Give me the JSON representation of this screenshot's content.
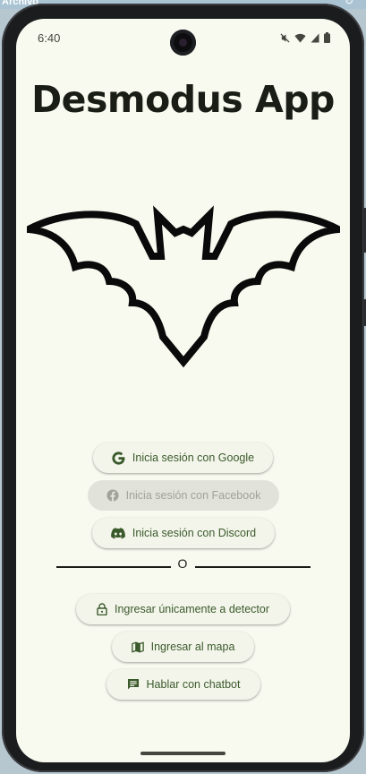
{
  "host": {
    "title": "Archivo"
  },
  "status_bar": {
    "time": "6:40",
    "icons": [
      "mute-icon",
      "wifi-icon",
      "signal-icon",
      "battery-icon"
    ]
  },
  "app": {
    "title": "Desmodus App",
    "logo": "bat-icon"
  },
  "login_buttons": [
    {
      "label": "Inicia sesión con Google",
      "icon": "google-icon",
      "enabled": true
    },
    {
      "label": "Inicia sesión con Facebook",
      "icon": "facebook-icon",
      "enabled": false
    },
    {
      "label": "Inicia sesión con Discord",
      "icon": "discord-icon",
      "enabled": true
    }
  ],
  "divider": {
    "text": "O"
  },
  "action_buttons": [
    {
      "label": "Ingresar únicamente a detector",
      "icon": "lock-icon"
    },
    {
      "label": "Ingresar al mapa",
      "icon": "map-icon"
    },
    {
      "label": "Hablar con chatbot",
      "icon": "chat-icon"
    }
  ],
  "colors": {
    "background": "#f8faf0",
    "accent_text": "#3b5a2b",
    "title_text": "#1a1d16",
    "disabled_bg": "#e1e3da",
    "disabled_text": "#a0a29b"
  }
}
